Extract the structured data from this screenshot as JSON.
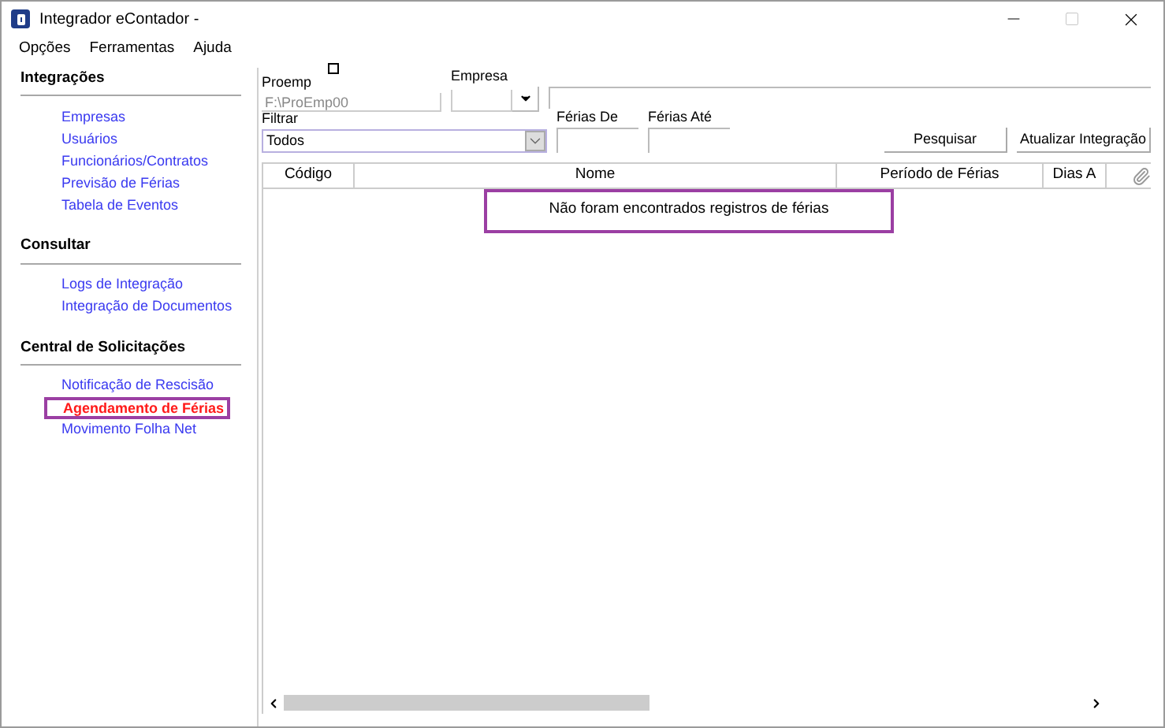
{
  "window": {
    "title": "Integrador eContador -"
  },
  "menu": [
    "Opções",
    "Ferramentas",
    "Ajuda"
  ],
  "sidebar": [
    {
      "heading": "Integrações",
      "items": [
        {
          "label": "Empresas",
          "selected": false
        },
        {
          "label": "Usuários",
          "selected": false
        },
        {
          "label": "Funcionários/Contratos",
          "selected": false
        },
        {
          "label": "Previsão de Férias",
          "selected": false
        },
        {
          "label": "Tabela de Eventos",
          "selected": false
        }
      ]
    },
    {
      "heading": "Consultar",
      "items": [
        {
          "label": "Logs de Integração",
          "selected": false
        },
        {
          "label": "Integração de Documentos",
          "selected": false
        }
      ]
    },
    {
      "heading": "Central de Solicitações",
      "items": [
        {
          "label": "Notificação de Rescisão",
          "selected": false
        },
        {
          "label": "Agendamento de Férias",
          "selected": true
        },
        {
          "label": "Movimento Folha Net",
          "selected": false
        }
      ]
    }
  ],
  "form": {
    "proemp": {
      "label": "Proemp",
      "value": "F:\\ProEmp00",
      "checked": false
    },
    "empresa": {
      "label": "Empresa"
    },
    "filtrar": {
      "label": "Filtrar",
      "value": "Todos"
    },
    "ferias_de": {
      "label": "Férias De"
    },
    "ferias_ate": {
      "label": "Férias Até"
    },
    "buttons": [
      "Pesquisar",
      "Atualizar Integração"
    ]
  },
  "table": {
    "columns": [
      "Código",
      "Nome",
      "Período de Férias",
      "Dias A"
    ],
    "empty_message": "Não foram encontrados registros de férias"
  }
}
